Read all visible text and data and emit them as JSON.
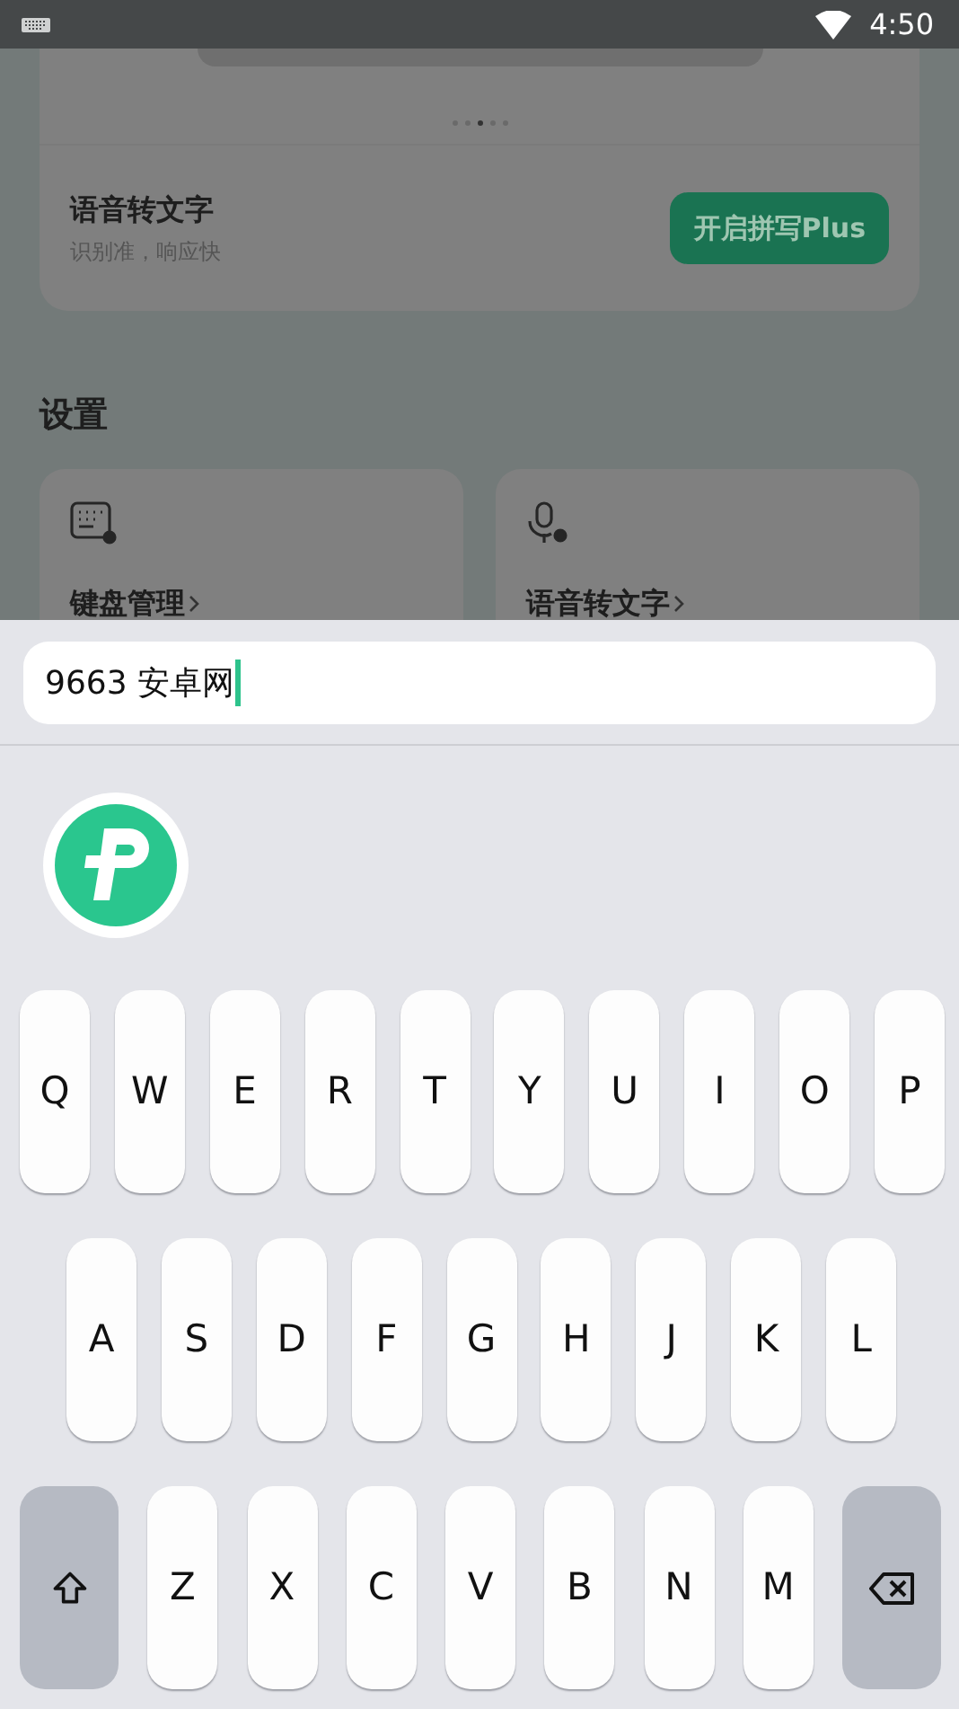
{
  "status_bar": {
    "time": "4:50"
  },
  "promo_card": {
    "dots": [
      {
        "selected": false
      },
      {
        "selected": false
      },
      {
        "selected": true
      },
      {
        "selected": false
      },
      {
        "selected": false
      }
    ],
    "title": "语音转文字",
    "subtitle": "识别准，响应快",
    "button": "开启拼写Plus"
  },
  "settings": {
    "heading": "设置",
    "cards": [
      {
        "kind": "keyboard",
        "label": "键盘管理"
      },
      {
        "kind": "voice",
        "label": "语音转文字"
      }
    ]
  },
  "input": {
    "value": "9663 安卓网"
  },
  "keyboard": {
    "rows": [
      [
        {
          "kind": "letter",
          "label": "Q"
        },
        {
          "kind": "letter",
          "label": "W"
        },
        {
          "kind": "letter",
          "label": "E"
        },
        {
          "kind": "letter",
          "label": "R"
        },
        {
          "kind": "letter",
          "label": "T"
        },
        {
          "kind": "letter",
          "label": "Y"
        },
        {
          "kind": "letter",
          "label": "U"
        },
        {
          "kind": "letter",
          "label": "I"
        },
        {
          "kind": "letter",
          "label": "O"
        },
        {
          "kind": "letter",
          "label": "P"
        }
      ],
      [
        {
          "kind": "letter",
          "label": "A"
        },
        {
          "kind": "letter",
          "label": "S"
        },
        {
          "kind": "letter",
          "label": "D"
        },
        {
          "kind": "letter",
          "label": "F"
        },
        {
          "kind": "letter",
          "label": "G"
        },
        {
          "kind": "letter",
          "label": "H"
        },
        {
          "kind": "letter",
          "label": "J"
        },
        {
          "kind": "letter",
          "label": "K"
        },
        {
          "kind": "letter",
          "label": "L"
        }
      ],
      [
        {
          "kind": "shift"
        },
        {
          "kind": "letter",
          "label": "Z"
        },
        {
          "kind": "letter",
          "label": "X"
        },
        {
          "kind": "letter",
          "label": "C"
        },
        {
          "kind": "letter",
          "label": "V"
        },
        {
          "kind": "letter",
          "label": "B"
        },
        {
          "kind": "letter",
          "label": "N"
        },
        {
          "kind": "letter",
          "label": "M"
        },
        {
          "kind": "delete"
        }
      ]
    ]
  }
}
